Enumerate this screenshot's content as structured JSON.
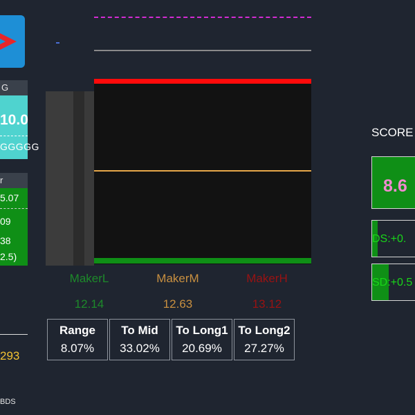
{
  "left_panel": {
    "logo_icon": "arrow-logo-icon",
    "header_1": "G",
    "cyan_value": "10.0",
    "cyan_sub": "GGGGG",
    "header_2": "r",
    "list": [
      "5.07",
      "09",
      "38",
      "2.5)"
    ],
    "number": "293",
    "footer": "BDS"
  },
  "chart": {
    "makers": [
      {
        "label": "MakerL",
        "value": "12.14",
        "color": "#1d8a2a"
      },
      {
        "label": "MakerM",
        "value": "12.63",
        "color": "#c99040"
      },
      {
        "label": "MakerH",
        "value": "13.12",
        "color": "#9a1212"
      }
    ],
    "line_colors": {
      "top_dashed": "#d42bd4",
      "gray": "#8a8a8a",
      "red": "#ff0a0a",
      "mid": "#e8a84a",
      "green": "#0f8f16"
    }
  },
  "stats": [
    {
      "label": "Range",
      "value": "8.07%"
    },
    {
      "label": "To Mid",
      "value": "33.02%"
    },
    {
      "label": "To Long1",
      "value": "20.69%"
    },
    {
      "label": "To Long2",
      "value": "27.27%"
    }
  ],
  "right_panel": {
    "score_title": "SCORE",
    "score_value": "8.6",
    "ds_label": "DS:+0.",
    "sd_label": "SD:+0.5"
  }
}
